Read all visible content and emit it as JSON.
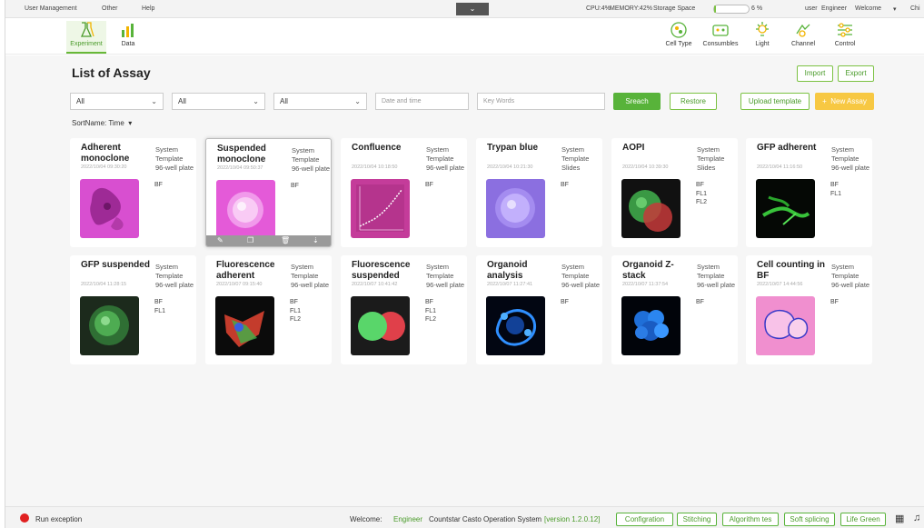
{
  "system_bar": {
    "menu": [
      "User Management",
      "Other",
      "Help"
    ],
    "dropdown_icon": "chevron-down-icon",
    "cpu": "CPU:4%",
    "memory": "MEMORY:42%",
    "storage_label": "Storage Space",
    "storage_pct_text": "6 %",
    "storage_fraction": 0.06,
    "user_label": "user",
    "user_name": "Engineer",
    "welcome": "Welcome",
    "language_truncated": "Chi"
  },
  "toolbar": {
    "left": [
      {
        "label": "Experiment",
        "icon": "flask-icon",
        "active": true
      },
      {
        "label": "Data",
        "icon": "bar-chart-icon",
        "active": false
      }
    ],
    "right": [
      {
        "label": "Cell Type",
        "icon": "cell-type-icon"
      },
      {
        "label": "Consumbles",
        "icon": "consumables-icon"
      },
      {
        "label": "Light",
        "icon": "light-icon"
      },
      {
        "label": "Channel",
        "icon": "channel-icon"
      },
      {
        "label": "Control",
        "icon": "sliders-icon"
      }
    ]
  },
  "page": {
    "title": "List of Assay",
    "import_label": "Import",
    "export_label": "Export",
    "filters": [
      "All",
      "All",
      "All"
    ],
    "date_placeholder": "Date and time",
    "keywords_placeholder": "Key Words",
    "search_label": "Sreach",
    "restore_label": "Restore",
    "upload_label": "Upload template",
    "new_assay_label": "New Assay",
    "new_assay_icon": "+",
    "sort_label": "SortName: Time",
    "sort_icon": "caret-down-icon"
  },
  "assays": [
    {
      "name": "Adherent monoclone",
      "date": "2022/10/04 09:30:20",
      "type": [
        "System",
        "Template",
        "96-well plate"
      ],
      "channels": [
        "BF"
      ],
      "thumb": "magenta-adherent"
    },
    {
      "name": "Suspended monoclone",
      "date": "2022/10/04 09:50:37",
      "type": [
        "System",
        "Template",
        "96-well plate"
      ],
      "channels": [
        "BF"
      ],
      "thumb": "pink-suspended",
      "hover": true
    },
    {
      "name": "Confluence",
      "date": "2022/10/04 10:18:50",
      "type": [
        "System",
        "Template",
        "96-well plate"
      ],
      "channels": [
        "BF"
      ],
      "thumb": "confluence-chart"
    },
    {
      "name": "Trypan blue",
      "date": "2022/10/04 10:21:30",
      "type": [
        "System",
        "Template",
        "Slides"
      ],
      "channels": [
        "BF"
      ],
      "thumb": "purple-cell"
    },
    {
      "name": "AOPI",
      "date": "2022/10/04 10:39:30",
      "type": [
        "System",
        "Template",
        "Slides"
      ],
      "channels": [
        "BF",
        "FL1",
        "FL2"
      ],
      "thumb": "green-red-cells"
    },
    {
      "name": "GFP adherent",
      "date": "2022/10/04 11:16:50",
      "type": [
        "System",
        "Template",
        "96-well plate"
      ],
      "channels": [
        "BF",
        "FL1"
      ],
      "thumb": "green-streaks"
    },
    {
      "name": "GFP suspended",
      "date": "2022/10/04 11:28:15",
      "type": [
        "System",
        "Template",
        "96-well plate"
      ],
      "channels": [
        "BF",
        "FL1"
      ],
      "thumb": "green-cell"
    },
    {
      "name": "Fluorescence adherent",
      "date": "2022/10/07 09:15:40",
      "type": [
        "System",
        "Template",
        "96-well plate"
      ],
      "channels": [
        "BF",
        "FL1",
        "FL2"
      ],
      "thumb": "multi-fluor"
    },
    {
      "name": "Fluorescence suspended",
      "date": "2022/10/07 10:41:42",
      "type": [
        "System",
        "Template",
        "96-well plate"
      ],
      "channels": [
        "BF",
        "FL1",
        "FL2"
      ],
      "thumb": "green-red-pair"
    },
    {
      "name": "Organoid analysis",
      "date": "2022/10/07 11:27:41",
      "type": [
        "System",
        "Template",
        "96-well plate"
      ],
      "channels": [
        "BF"
      ],
      "thumb": "blue-organoid"
    },
    {
      "name": "Organoid Z-stack",
      "date": "2022/10/07 11:37:54",
      "type": [
        "System",
        "Template",
        "96-well plate"
      ],
      "channels": [
        "BF"
      ],
      "thumb": "blue-spheres"
    },
    {
      "name": "Cell counting in BF",
      "date": "2022/10/07 14:44:56",
      "type": [
        "System",
        "Template",
        "96-well plate"
      ],
      "channels": [
        "BF"
      ],
      "thumb": "pink-outlined"
    }
  ],
  "card_actions": [
    {
      "icon": "edit-icon",
      "glyph": "✎"
    },
    {
      "icon": "copy-icon",
      "glyph": "❐"
    },
    {
      "icon": "delete-icon",
      "glyph": "🗑"
    },
    {
      "icon": "download-icon",
      "glyph": "⇣"
    }
  ],
  "status_bar": {
    "status_text": "Run exception",
    "welcome_label": "Welcome:",
    "user": "Engineer",
    "system_name": "Countstar Casto Operation System",
    "version": "[version 1.2.0.12]",
    "buttons": [
      "Configration",
      "Stitching",
      "Algorithm tes",
      "Soft splicing",
      "Life Green"
    ],
    "icons": [
      "calculator-icon",
      "music-icon"
    ]
  },
  "colors": {
    "accent": "#58b33a",
    "accent_text": "#4a9b2a",
    "new_assay": "#f7c843",
    "error": "#e02020"
  }
}
